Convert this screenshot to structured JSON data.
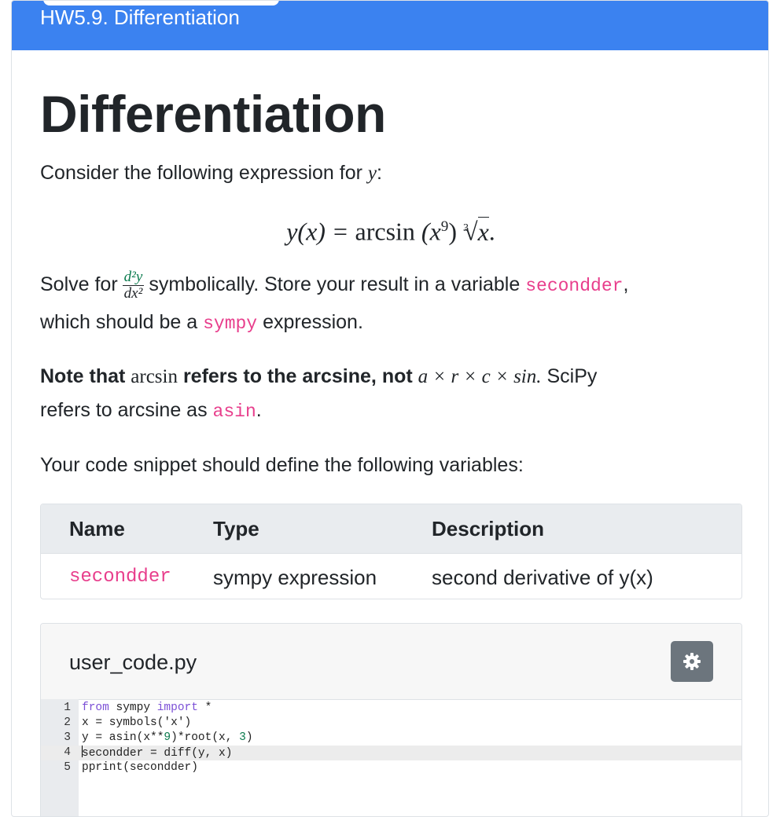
{
  "header": {
    "title": "HW5.9. Differentiation",
    "background": "#3b82f0"
  },
  "main": {
    "title": "Differentiation",
    "intro": {
      "before": "Consider the following expression for ",
      "var": "y",
      "after": ":"
    },
    "equation": {
      "lhs": "y(x) = ",
      "func": "arcsin",
      "arg": "(x",
      "exp": "9",
      "close": ")",
      "root_index": "3",
      "radicand": "x",
      "end": "."
    },
    "solve": {
      "before": "Solve for",
      "frac_num": "d²y",
      "frac_den": "dx²",
      "mid": "symbolically. Store your result in a variable",
      "var": "secondder",
      "comma": ",",
      "line2_before": "which should be a",
      "type": "sympy",
      "line2_after": "expression."
    },
    "note": {
      "before": "Note that",
      "func": "arcsin",
      "mid": "refers to the arcsine, not",
      "product": "a × r × c × sin.",
      "after": "SciPy",
      "line2_before": "refers to arcsine as",
      "code": "asin",
      "line2_after": "."
    },
    "vars_intro": "Your code snippet should define the following variables:"
  },
  "variables_table": {
    "headers": [
      "Name",
      "Type",
      "Description"
    ],
    "rows": [
      {
        "name": "secondder",
        "type": "sympy expression",
        "description": "second derivative of y(x)"
      }
    ]
  },
  "code_panel": {
    "file_name": "user_code.py",
    "settings_icon": "gear-icon",
    "lines": [
      {
        "n": "1",
        "text": "from sympy import *"
      },
      {
        "n": "2",
        "text": "x = symbols('x')"
      },
      {
        "n": "3",
        "text": "y = asin(x**9)*root(x, 3)"
      },
      {
        "n": "4",
        "text": "secondder = diff(y, x)"
      },
      {
        "n": "5",
        "text": "pprint(secondder)"
      }
    ]
  },
  "colors": {
    "accent": "#3b82f0",
    "code_inline": "#e83e8c",
    "keyword": "#7b4fd6",
    "number": "#0a7a4d"
  }
}
